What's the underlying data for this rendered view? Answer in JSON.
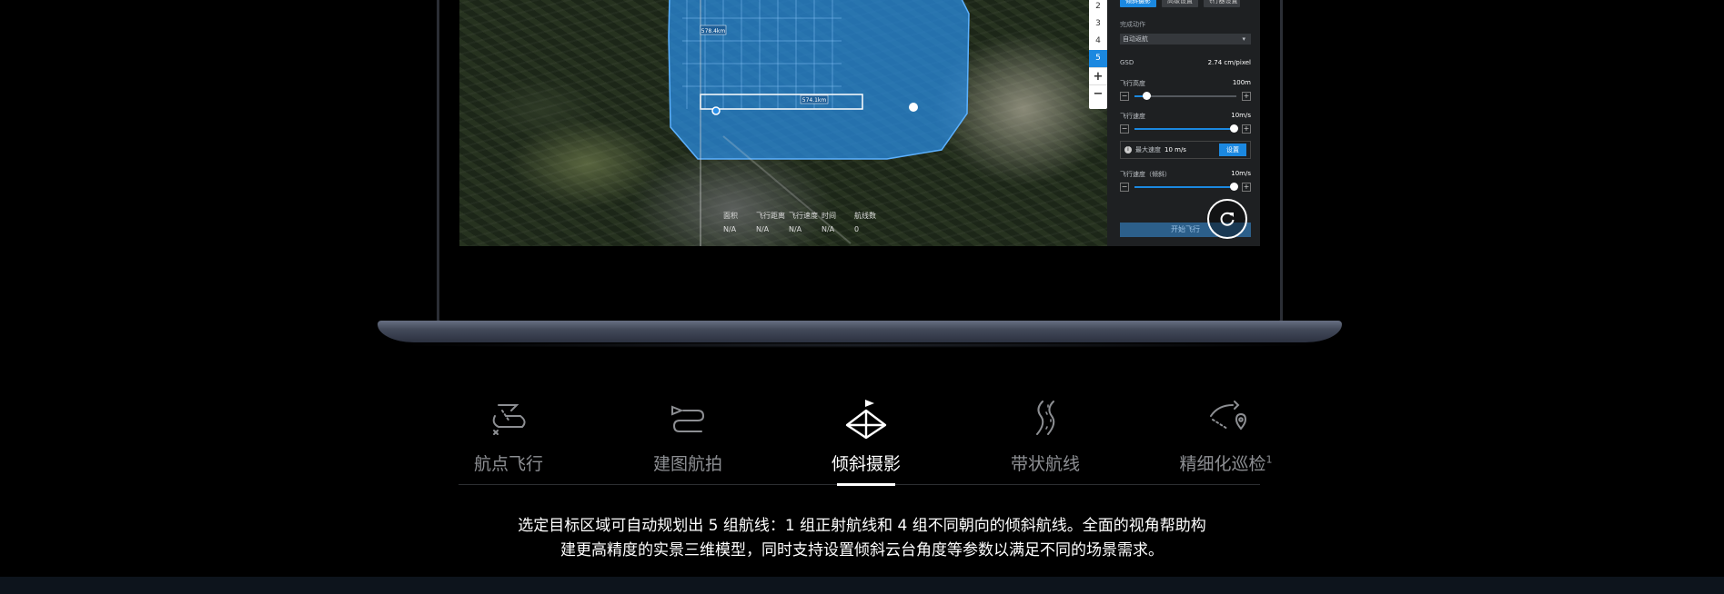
{
  "map": {
    "zoom_levels": [
      "2",
      "3",
      "4",
      "5"
    ],
    "zoom_active": "5",
    "zoom_in": "+",
    "zoom_out": "−",
    "area_labels": [
      "578.4km",
      "574.1km"
    ],
    "stats": {
      "headers": [
        "面积",
        "飞行距离",
        "飞行速度",
        "时间",
        "航线数"
      ],
      "values": [
        "N/A",
        "N/A",
        "N/A",
        "N/A",
        "0"
      ]
    }
  },
  "panel": {
    "tabs": [
      "倾斜摄影",
      "高级设置",
      "飞行器设置"
    ],
    "finish_action_label": "完成动作",
    "finish_action_value": "自动返航",
    "gsd_label": "GSD",
    "gsd_value": "2.74 cm/pixel",
    "altitude_label": "飞行高度",
    "altitude_value": "100m",
    "altitude_level": 0.12,
    "speed_label": "飞行速度",
    "speed_value": "10m/s",
    "speed_level": 0.97,
    "max_speed_label": "最大速度",
    "max_speed_value": "10 m/s",
    "set_button": "设置",
    "oblique_speed_label": "飞行速度（倾斜）",
    "oblique_speed_value": "10m/s",
    "oblique_speed_level": 0.97,
    "start_button": "开始飞行",
    "minus": "−",
    "plus": "+"
  },
  "tabs": [
    {
      "label": "航点飞行",
      "icon": "waypoint-flight-icon",
      "active": false
    },
    {
      "label": "建图航拍",
      "icon": "mapping-aerial-icon",
      "active": false
    },
    {
      "label": "倾斜摄影",
      "icon": "oblique-photography-icon",
      "active": true
    },
    {
      "label": "带状航线",
      "icon": "corridor-route-icon",
      "active": false
    },
    {
      "label": "精细化巡检",
      "icon": "fine-inspection-icon",
      "active": false,
      "sup": "1"
    }
  ],
  "description": {
    "line1": "选定目标区域可自动规划出 5 组航线：1 组正射航线和 4 组不同朝向的倾斜航线。全面的视角帮助构",
    "line2": "建更高精度的实景三维模型，同时支持设置倾斜云台角度等参数以满足不同的场景需求。"
  },
  "colors": {
    "accent": "#1b88e0",
    "area_fill": "#2a8fe8",
    "background": "#000000"
  }
}
